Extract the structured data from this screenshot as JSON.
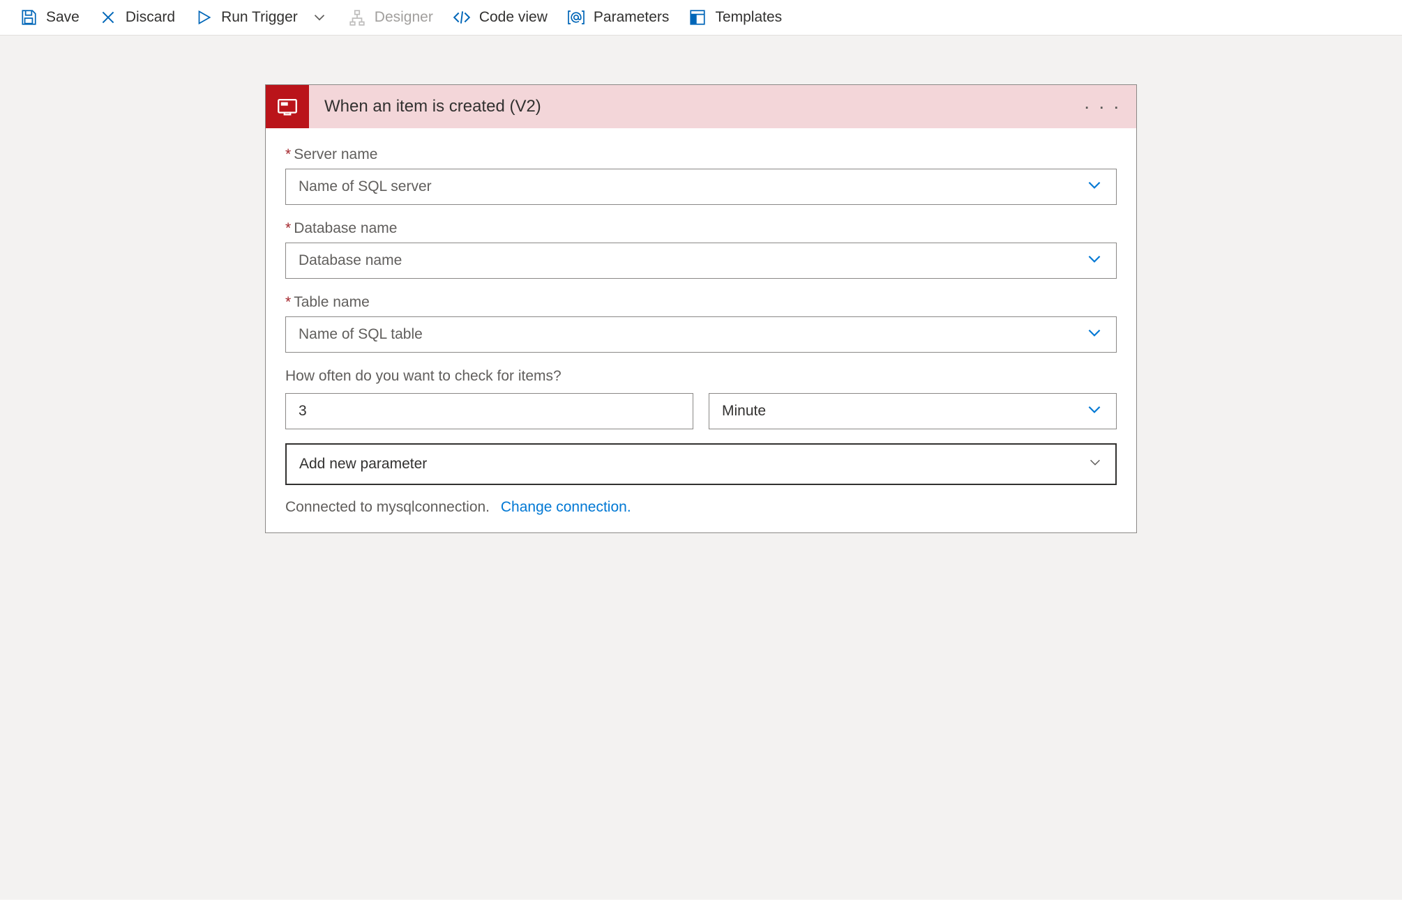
{
  "toolbar": {
    "save": "Save",
    "discard": "Discard",
    "run_trigger": "Run Trigger",
    "designer": "Designer",
    "code_view": "Code view",
    "parameters": "Parameters",
    "templates": "Templates"
  },
  "card": {
    "title": "When an item is created (V2)",
    "fields": {
      "server_name": {
        "label": "Server name",
        "placeholder": "Name of SQL server"
      },
      "database_name": {
        "label": "Database name",
        "placeholder": "Database name"
      },
      "table_name": {
        "label": "Table name",
        "placeholder": "Name of SQL table"
      },
      "frequency_label": "How often do you want to check for items?",
      "interval_value": "3",
      "unit_value": "Minute",
      "add_param": "Add new parameter"
    },
    "footer": {
      "connected_text": "Connected to mysqlconnection.",
      "change_link": "Change connection."
    }
  }
}
